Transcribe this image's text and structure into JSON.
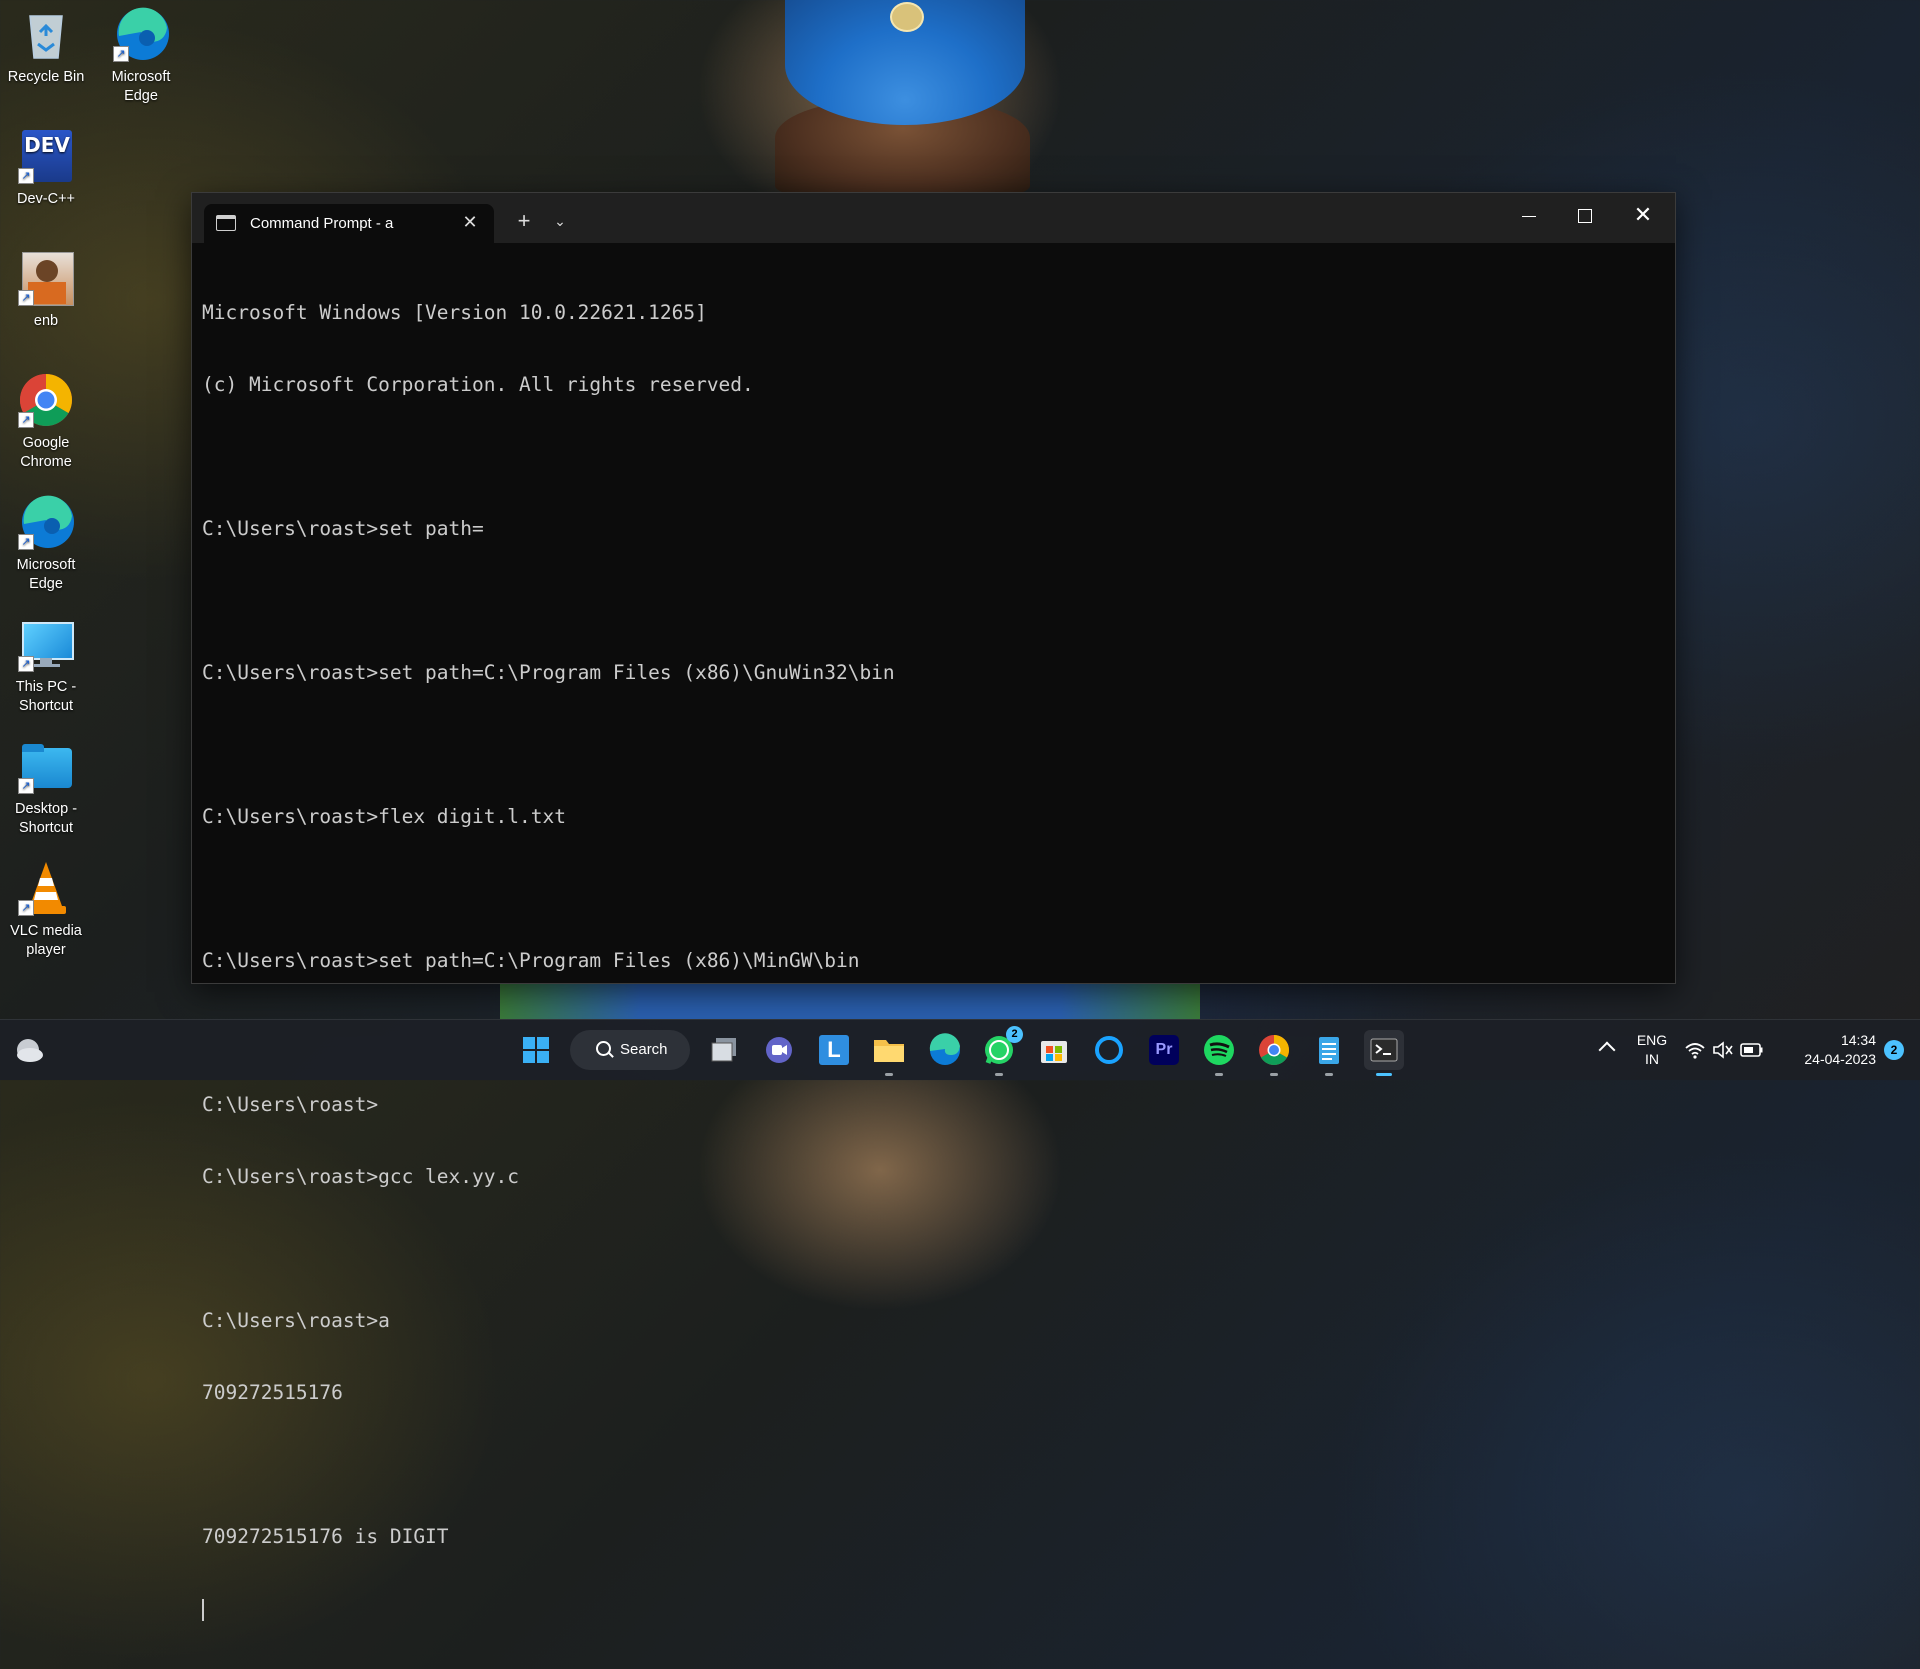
{
  "desktop": {
    "icons": [
      {
        "label": "Recycle Bin"
      },
      {
        "label": "Microsoft Edge"
      },
      {
        "label": "Dev-C++"
      },
      {
        "label": "enb"
      },
      {
        "label": "Google Chrome"
      },
      {
        "label": "Microsoft Edge"
      },
      {
        "label": "This PC - Shortcut"
      },
      {
        "label": "Desktop - Shortcut"
      },
      {
        "label": "VLC media player"
      }
    ],
    "devcpp_logo_text": "DEV"
  },
  "terminal": {
    "tab_title": "Command Prompt - a",
    "new_tab_symbol": "+",
    "dropdown_symbol": "⌄",
    "close_symbol": "✕",
    "lines": [
      "Microsoft Windows [Version 10.0.22621.1265]",
      "(c) Microsoft Corporation. All rights reserved.",
      "",
      "C:\\Users\\roast>set path=",
      "",
      "C:\\Users\\roast>set path=C:\\Program Files (x86)\\GnuWin32\\bin",
      "",
      "C:\\Users\\roast>flex digit.l.txt",
      "",
      "C:\\Users\\roast>set path=C:\\Program Files (x86)\\MinGW\\bin",
      "",
      "C:\\Users\\roast>",
      "C:\\Users\\roast>gcc lex.yy.c",
      "",
      "C:\\Users\\roast>a",
      "709272515176",
      "",
      "709272515176 is DIGIT"
    ]
  },
  "taskbar": {
    "search_label": "Search",
    "apps": [
      {
        "name": "start"
      },
      {
        "name": "task-view"
      },
      {
        "name": "teams-chat"
      },
      {
        "name": "launcher-l",
        "glyph": "L"
      },
      {
        "name": "file-explorer"
      },
      {
        "name": "edge"
      },
      {
        "name": "whatsapp",
        "badge": "2"
      },
      {
        "name": "microsoft-store"
      },
      {
        "name": "cortana"
      },
      {
        "name": "premiere-pro",
        "glyph": "Pr"
      },
      {
        "name": "spotify"
      },
      {
        "name": "chrome"
      },
      {
        "name": "notepad"
      },
      {
        "name": "terminal"
      }
    ],
    "tray": {
      "lang_line1": "ENG",
      "lang_line2": "IN",
      "time": "14:34",
      "date": "24-04-2023",
      "notification_count": "2"
    }
  },
  "colors": {
    "terminal_bg": "#0c0c0c",
    "terminal_text": "#cccccc",
    "titlebar_bg": "#202020",
    "accent": "#4cc2ff"
  }
}
